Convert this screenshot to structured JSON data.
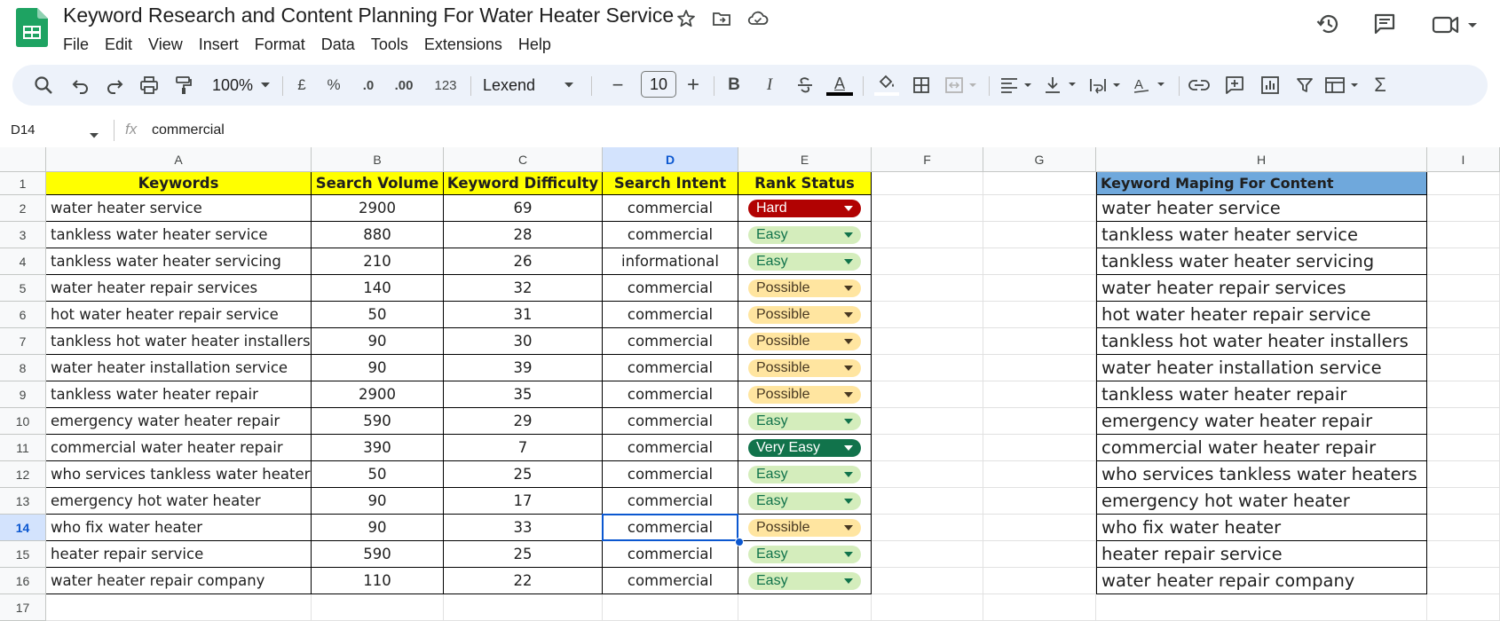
{
  "doc_title": "Keyword Research and Content Planning For Water Heater Service",
  "menu": [
    "File",
    "Edit",
    "View",
    "Insert",
    "Format",
    "Data",
    "Tools",
    "Extensions",
    "Help"
  ],
  "toolbar": {
    "zoom": "100%",
    "currency": "£",
    "percent": "%",
    "dec_decrease": ".0",
    "dec_increase": ".00",
    "number_format": "123",
    "font": "Lexend",
    "font_size": "10",
    "minus": "−",
    "plus": "+",
    "bold": "B",
    "italic": "I",
    "text_color": "A"
  },
  "formula_bar": {
    "cell_ref": "D14",
    "fx": "fx",
    "content": "commercial"
  },
  "columns": [
    "A",
    "B",
    "C",
    "D",
    "E",
    "F",
    "G",
    "H",
    "I"
  ],
  "rows": [
    "1",
    "2",
    "3",
    "4",
    "5",
    "6",
    "7",
    "8",
    "9",
    "10",
    "11",
    "12",
    "13",
    "14",
    "15",
    "16",
    "17"
  ],
  "table": {
    "headers": [
      "Keywords",
      "Search Volume",
      "Keyword Difficulty",
      "Search Intent",
      "Rank Status"
    ],
    "rows": [
      [
        "water heater service",
        "2900",
        "69",
        "commercial",
        "Hard"
      ],
      [
        "tankless water heater service",
        "880",
        "28",
        "commercial",
        "Easy"
      ],
      [
        "tankless water heater servicing",
        "210",
        "26",
        "informational",
        "Easy"
      ],
      [
        "water heater repair services",
        "140",
        "32",
        "commercial",
        "Possible"
      ],
      [
        "hot water heater repair service",
        "50",
        "31",
        "commercial",
        "Possible"
      ],
      [
        "tankless hot water heater installers",
        "90",
        "30",
        "commercial",
        "Possible"
      ],
      [
        "water heater installation service",
        "90",
        "39",
        "commercial",
        "Possible"
      ],
      [
        "tankless water heater repair",
        "2900",
        "35",
        "commercial",
        "Possible"
      ],
      [
        "emergency water heater repair",
        "590",
        "29",
        "commercial",
        "Easy"
      ],
      [
        "commercial water heater repair",
        "390",
        "7",
        "commercial",
        "Very Easy"
      ],
      [
        "who services tankless water heaters",
        "50",
        "25",
        "commercial",
        "Easy"
      ],
      [
        "emergency hot water heater",
        "90",
        "17",
        "commercial",
        "Easy"
      ],
      [
        "who fix water heater",
        "90",
        "33",
        "commercial",
        "Possible"
      ],
      [
        "heater repair service",
        "590",
        "25",
        "commercial",
        "Easy"
      ],
      [
        "water heater repair company",
        "110",
        "22",
        "commercial",
        "Easy"
      ]
    ]
  },
  "status_styles": {
    "Hard": {
      "bg": "#b10202",
      "fg": "#ffffff"
    },
    "Easy": {
      "bg": "#d4edbc",
      "fg": "#11734b"
    },
    "Possible": {
      "bg": "#ffe5a0",
      "fg": "#473822"
    },
    "Very Easy": {
      "bg": "#11734b",
      "fg": "#ffffff"
    }
  },
  "mapping": {
    "header": "Keyword Maping For Content",
    "items": [
      "water heater service",
      "tankless water heater service",
      "tankless water heater servicing",
      "water heater repair services",
      "hot water heater repair service",
      "tankless hot water heater installers",
      "water heater installation service",
      "tankless water heater repair",
      "emergency water heater repair",
      "commercial water heater repair",
      "who services tankless water heaters",
      "emergency hot water heater",
      "who fix water heater",
      "heater repair service",
      "water heater repair company"
    ]
  },
  "selected_cell": {
    "col": "D",
    "row": "14"
  },
  "colors": {
    "accent": "#0b57d0",
    "header_yellow": "#ffff00",
    "mapping_header": "#6fa8dc",
    "toolbar_bg": "#edf2fa"
  }
}
